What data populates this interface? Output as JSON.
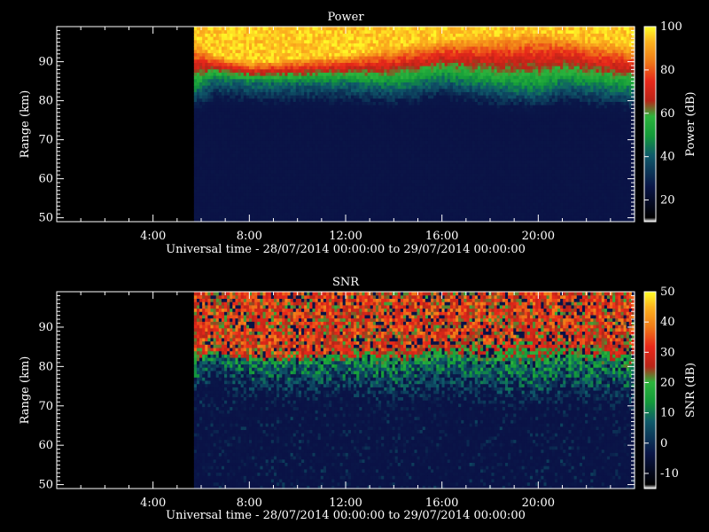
{
  "figure": {
    "background": "#000000",
    "foreground": "#ffffff"
  },
  "chart_data": [
    {
      "type": "heatmap",
      "title": "Power",
      "xlabel": "Universal time - 28/07/2014 00:00:00 to 29/07/2014 00:00:00",
      "ylabel": "Range (km)",
      "xlim": [
        0,
        24
      ],
      "xticks": [
        {
          "value": 4,
          "label": "4:00"
        },
        {
          "value": 8,
          "label": "8:00"
        },
        {
          "value": 12,
          "label": "12:00"
        },
        {
          "value": 16,
          "label": "16:00"
        },
        {
          "value": 20,
          "label": "20:00"
        }
      ],
      "ylim": [
        49,
        99
      ],
      "yticks": [
        50,
        60,
        70,
        80,
        90
      ],
      "colorbar": {
        "label": "Power (dB)",
        "range": [
          10,
          100
        ],
        "ticks": [
          20,
          40,
          60,
          80,
          100
        ]
      },
      "data_gap_hours": [
        0,
        5.7
      ],
      "data_summary": {
        "time_hours": [
          5.7,
          6.5,
          8,
          10,
          12,
          14,
          16,
          18,
          20,
          21,
          22,
          24
        ],
        "top_of_low_region_km": [
          75,
          78,
          77,
          77,
          77,
          76,
          78,
          76,
          75,
          77,
          76,
          75
        ],
        "range_of_mid_level_km": [
          83,
          86,
          85,
          85,
          85,
          84,
          86,
          84,
          83,
          85,
          84,
          83
        ],
        "bottom_of_peak_region_km": [
          95,
          92,
          90,
          91,
          92,
          94,
          96,
          97,
          98,
          97,
          96,
          94
        ],
        "low_level_db": 15,
        "mid_level_db": 45,
        "peak_level_db": 95
      }
    },
    {
      "type": "heatmap",
      "title": "SNR",
      "xlabel": "Universal time - 28/07/2014 00:00:00 to 29/07/2014 00:00:00",
      "ylabel": "Range (km)",
      "xlim": [
        0,
        24
      ],
      "xticks": [
        {
          "value": 4,
          "label": "4:00"
        },
        {
          "value": 8,
          "label": "8:00"
        },
        {
          "value": 12,
          "label": "12:00"
        },
        {
          "value": 16,
          "label": "16:00"
        },
        {
          "value": 20,
          "label": "20:00"
        }
      ],
      "ylim": [
        49,
        99
      ],
      "yticks": [
        50,
        60,
        70,
        80,
        90
      ],
      "colorbar": {
        "label": "SNR (dB)",
        "range": [
          -15,
          50
        ],
        "ticks": [
          -10,
          0,
          10,
          20,
          30,
          40,
          50
        ]
      },
      "data_gap_hours": [
        0,
        5.7
      ],
      "data_summary": {
        "time_hours": [
          5.7,
          6.5,
          8,
          10,
          12,
          14,
          16,
          18,
          20,
          21,
          22,
          24
        ],
        "top_of_low_region_km": [
          72,
          74,
          70,
          70,
          70,
          69,
          71,
          69,
          68,
          70,
          69,
          68
        ],
        "range_of_mid_level_km": [
          80,
          83,
          81,
          81,
          81,
          80,
          82,
          80,
          79,
          81,
          80,
          79
        ],
        "bottom_of_peak_region_km": [
          85,
          84,
          83,
          83,
          84,
          85,
          86,
          87,
          88,
          87,
          86,
          86
        ],
        "low_level_db": -10,
        "mid_level_db": 10,
        "peak_level_db": 30
      }
    }
  ]
}
